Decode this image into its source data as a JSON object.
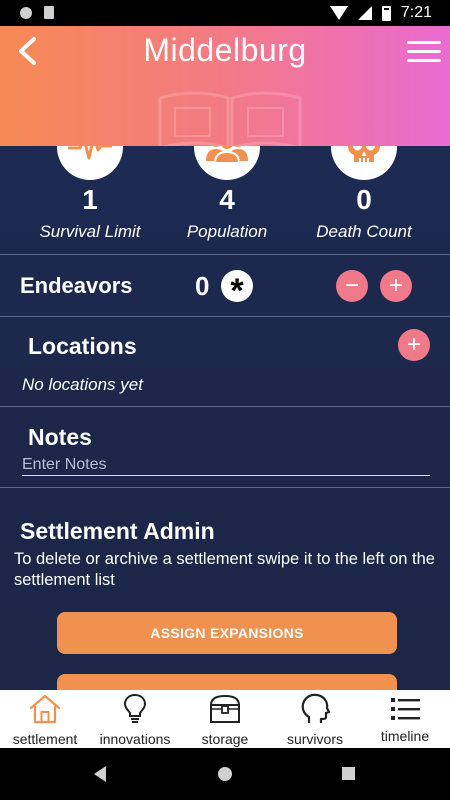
{
  "status_bar": {
    "time": "7:21"
  },
  "header": {
    "title": "Middelburg"
  },
  "stats": [
    {
      "value": "1",
      "label": "Survival Limit",
      "icon": "heartbeat-icon"
    },
    {
      "value": "4",
      "label": "Population",
      "icon": "people-icon"
    },
    {
      "value": "0",
      "label": "Death Count",
      "icon": "skull-icon"
    }
  ],
  "endeavors": {
    "label": "Endeavors",
    "value": "0",
    "decrement": "−",
    "increment": "+"
  },
  "locations": {
    "title": "Locations",
    "empty_text": "No locations yet",
    "add": "+"
  },
  "notes": {
    "title": "Notes",
    "placeholder": "Enter Notes"
  },
  "admin": {
    "title": "Settlement Admin",
    "text": "To delete or archive a settlement swipe it to the left on the settlement list",
    "button_label": "ASSIGN EXPANSIONS"
  },
  "nav": [
    {
      "label": "settlement",
      "icon": "house-icon"
    },
    {
      "label": "innovations",
      "icon": "lightbulb-icon"
    },
    {
      "label": "storage",
      "icon": "chest-icon"
    },
    {
      "label": "survivors",
      "icon": "head-icon"
    },
    {
      "label": "timeline",
      "icon": "list-icon"
    }
  ],
  "colors": {
    "accent_orange": "#f1914f",
    "accent_pink": "#f0798a",
    "header_start": "#f68a55",
    "header_end": "#e96bd4",
    "background": "#1d2a52"
  }
}
